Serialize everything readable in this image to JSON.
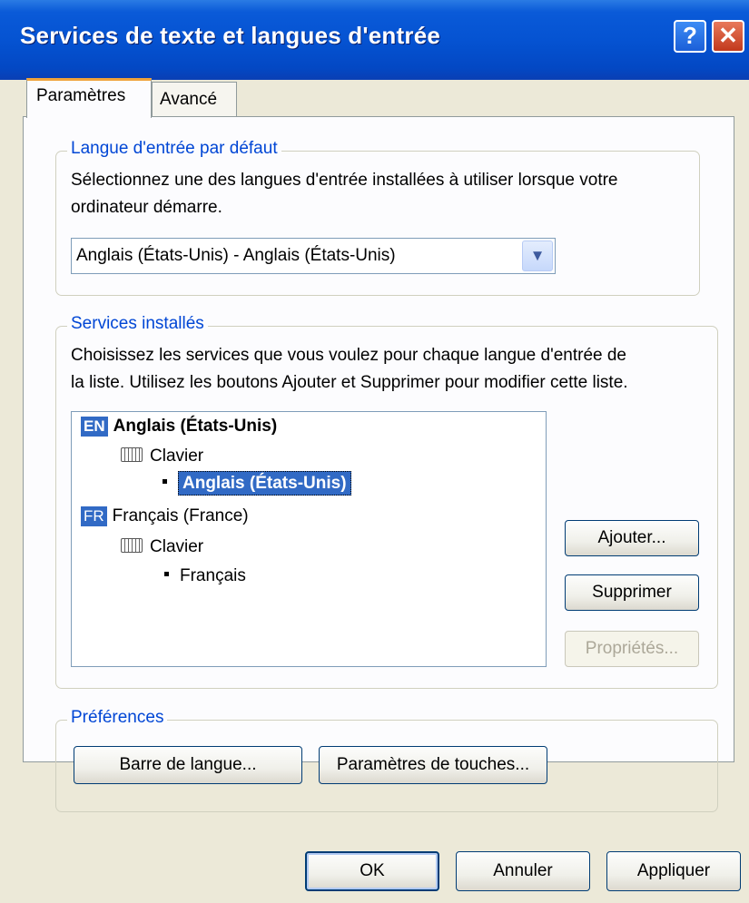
{
  "window": {
    "title": "Services de texte et langues d'entrée"
  },
  "titlebar_buttons": {
    "help": "?",
    "close": "✕"
  },
  "tabs": [
    {
      "label": "Paramètres",
      "active": true
    },
    {
      "label": "Avancé",
      "active": false
    }
  ],
  "default_language": {
    "legend": "Langue d'entrée par défaut",
    "description_line1": "Sélectionnez une des langues d'entrée installées à utiliser lorsque votre",
    "description_line2": "ordinateur démarre.",
    "selected_value": "Anglais (États-Unis) - Anglais (États-Unis)"
  },
  "installed_services": {
    "legend": "Services installés",
    "description_line1": "Choisissez les services que vous voulez pour chaque langue d'entrée de",
    "description_line2": "la liste. Utilisez les boutons Ajouter et Supprimer pour modifier cette liste.",
    "tree": [
      {
        "badge": "EN",
        "label": "Anglais (États-Unis)",
        "category": "Clavier",
        "item": "Anglais (États-Unis)",
        "item_selected": true
      },
      {
        "badge": "FR",
        "label": "Français (France)",
        "category": "Clavier",
        "item": "Français",
        "item_selected": false
      }
    ],
    "buttons": {
      "add": "Ajouter...",
      "remove": "Supprimer",
      "properties": "Propriétés..."
    }
  },
  "preferences": {
    "legend": "Préférences",
    "language_bar_button": "Barre de langue...",
    "key_settings_button": "Paramètres de touches..."
  },
  "footer": {
    "ok": "OK",
    "cancel": "Annuler",
    "apply": "Appliquer"
  },
  "colors": {
    "title_bar": "#0553d2",
    "legend_text": "#0046d5",
    "selection": "#316ac5",
    "dialog_bg": "#ece9d8"
  }
}
